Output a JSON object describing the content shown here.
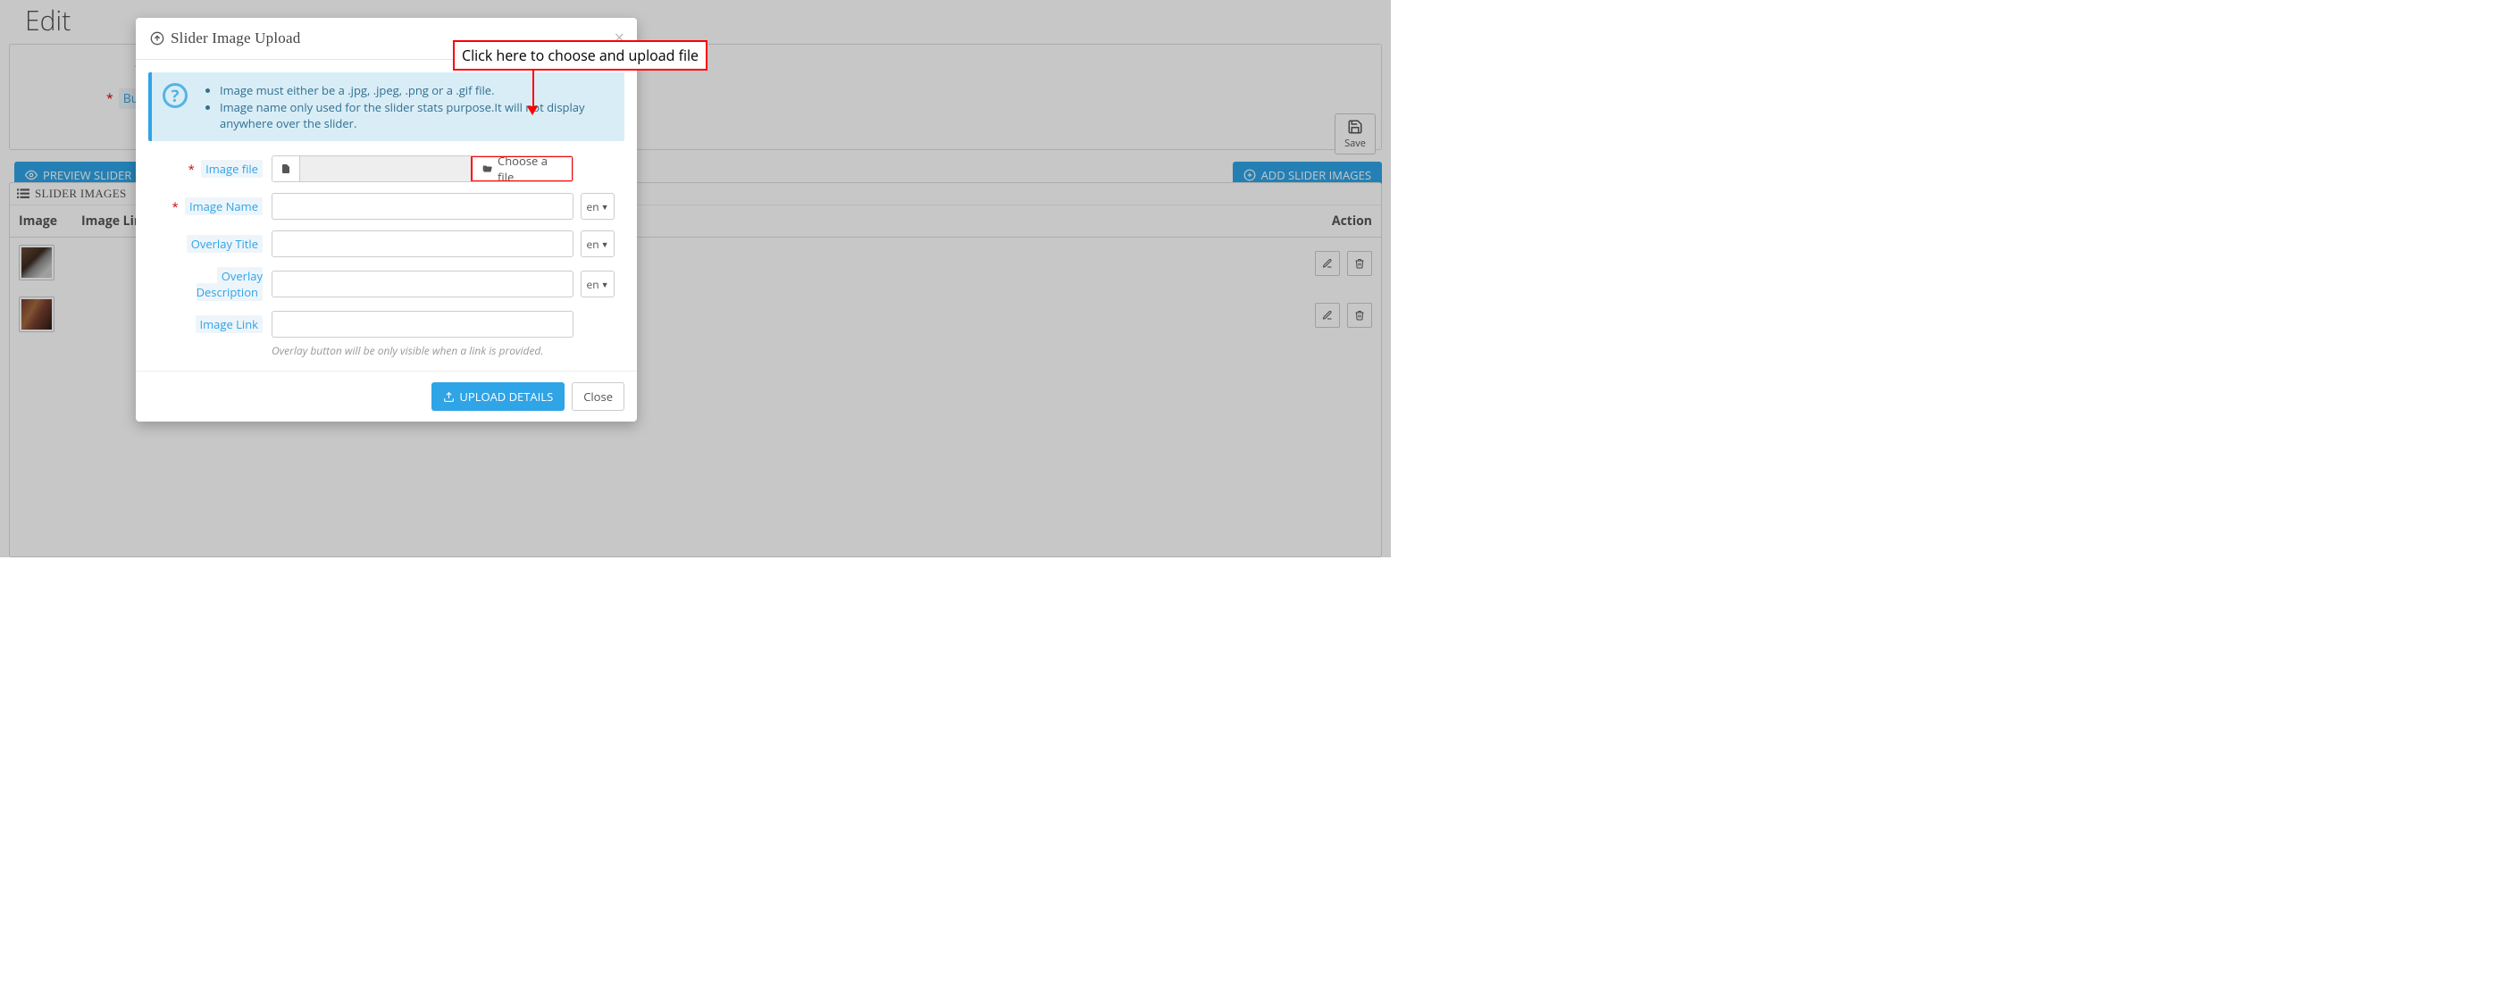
{
  "page": {
    "title": "Edit"
  },
  "panel": {
    "req_text": "*",
    "btn_field_label": "Buttoi"
  },
  "actions": {
    "save_label": "Save",
    "preview_label": "PREVIEW SLIDER",
    "add_label": "ADD SLIDER IMAGES"
  },
  "table": {
    "heading": "SLIDER IMAGES",
    "headers": {
      "image": "Image",
      "link": "Image Link",
      "action": "Action"
    }
  },
  "modal": {
    "title": "Slider Image Upload",
    "info": {
      "items": [
        "Image must either be a .jpg, .jpeg, .png or a .gif file.",
        "Image name only used for the slider stats purpose.It will not display anywhere over the slider."
      ]
    },
    "labels": {
      "image_file": "Image file",
      "image_name": "Image Name",
      "overlay_title": "Overlay Title",
      "overlay_desc": "Overlay Description",
      "image_link": "Image Link"
    },
    "choose_file": "Choose a file",
    "lang": "en",
    "help_text": "Overlay button will be only visible when a link is provided.",
    "footer": {
      "upload_label": "UPLOAD DETAILS",
      "close_label": "Close"
    }
  },
  "annotation": {
    "text": "Click here to choose and upload file"
  }
}
